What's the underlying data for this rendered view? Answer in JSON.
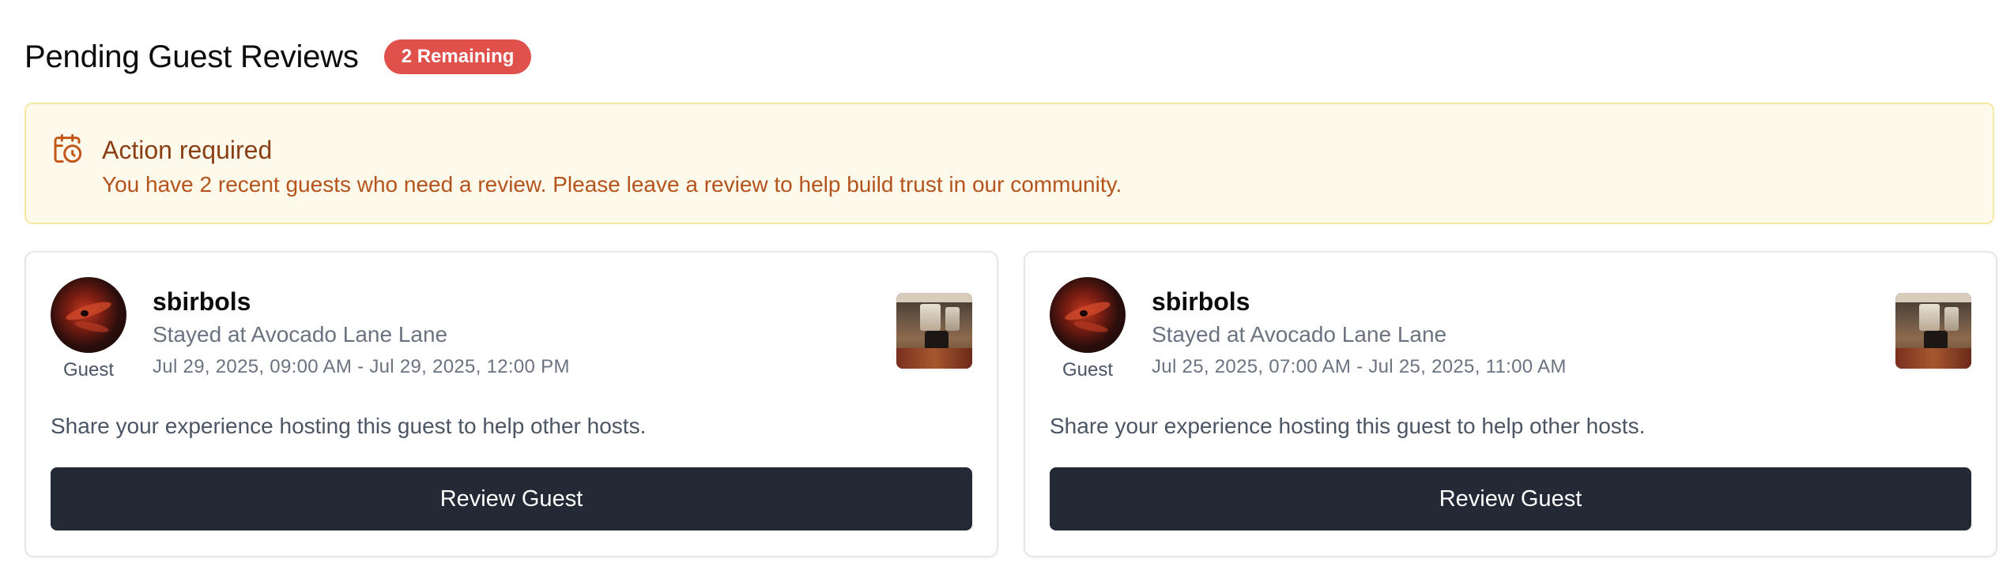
{
  "header": {
    "title": "Pending Guest Reviews",
    "badge": "2 Remaining"
  },
  "alert": {
    "icon": "calendar-clock-icon",
    "title": "Action required",
    "message": "You have 2 recent guests who need a review. Please leave a review to help build trust in our community."
  },
  "cards": [
    {
      "guest_name": "sbirbols",
      "role": "Guest",
      "stayed": "Stayed at Avocado Lane Lane",
      "dates": "Jul 29, 2025, 09:00 AM - Jul 29, 2025, 12:00 PM",
      "description": "Share your experience hosting this guest to help other hosts.",
      "button": "Review Guest"
    },
    {
      "guest_name": "sbirbols",
      "role": "Guest",
      "stayed": "Stayed at Avocado Lane Lane",
      "dates": "Jul 25, 2025, 07:00 AM - Jul 25, 2025, 11:00 AM",
      "description": "Share your experience hosting this guest to help other hosts.",
      "button": "Review Guest"
    }
  ],
  "colors": {
    "badge": "#e0514b",
    "alert_bg": "#fefaeb",
    "alert_border": "#f6e7a2",
    "alert_title": "#8b3f15",
    "alert_text": "#b4531c",
    "button_bg": "#232935"
  }
}
